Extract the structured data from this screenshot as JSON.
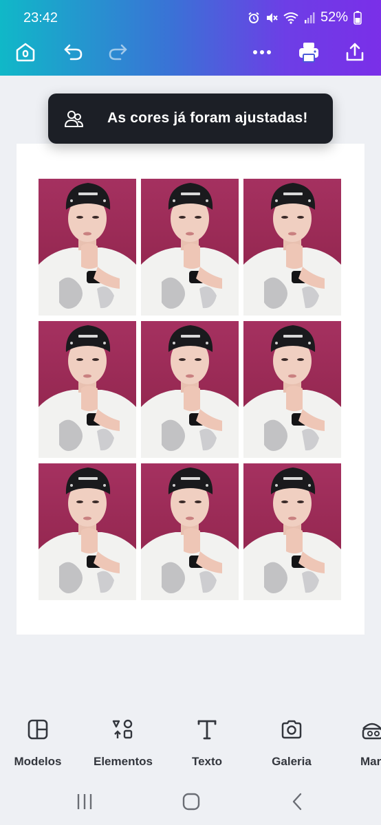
{
  "status_bar": {
    "time": "23:42",
    "battery": "52%",
    "icons": [
      "alarm-icon",
      "mute-icon",
      "wifi-icon",
      "signal-icon",
      "battery-icon"
    ]
  },
  "toolbar": {
    "left": [
      "home-icon",
      "undo-icon",
      "redo-icon"
    ],
    "right": [
      "more-icon",
      "print-icon",
      "share-icon"
    ]
  },
  "toast": {
    "message": "As cores já foram ajustadas!",
    "icon": "people-icon"
  },
  "canvas": {
    "photo_count": 9
  },
  "bottom_tools": [
    {
      "label": "Modelos",
      "icon": "templates-icon"
    },
    {
      "label": "Elementos",
      "icon": "elements-icon"
    },
    {
      "label": "Texto",
      "icon": "text-icon"
    },
    {
      "label": "Galeria",
      "icon": "camera-icon"
    },
    {
      "label": "Mar",
      "icon": "brand-icon"
    }
  ],
  "nav_bar": [
    "recent-apps-icon",
    "home-nav-icon",
    "back-icon"
  ],
  "colors": {
    "header_start": "#10b8c8",
    "header_end": "#7a2fe8",
    "toast_bg": "#1c1f26",
    "photo_bg": "#9a2a52"
  }
}
